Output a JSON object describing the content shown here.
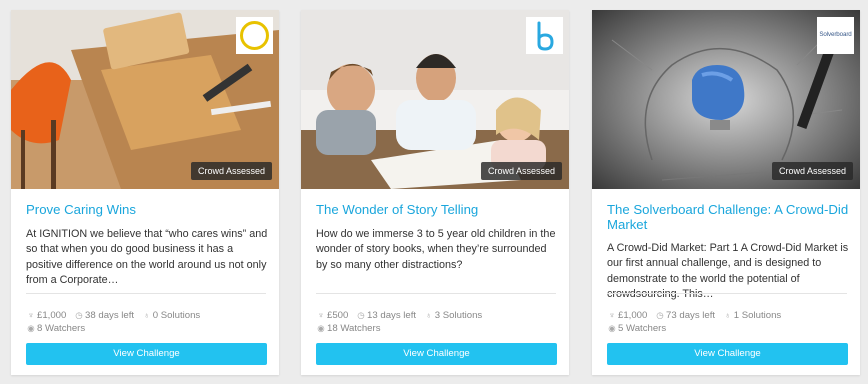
{
  "cards": [
    {
      "badge": "Crowd Assessed",
      "logo": "ignition-ring-logo",
      "title": "Prove Caring Wins",
      "description": "At IGNITION we believe that “who cares wins” and so that when you do good business it has a positive difference on the world around us not only from a Corporate…",
      "reward": "£1,000",
      "days_left": "38 days left",
      "solutions": "0 Solutions",
      "watchers": "8 Watchers",
      "button": "View Challenge"
    },
    {
      "badge": "Crowd Assessed",
      "logo": "b-letter-logo",
      "title": "The Wonder of Story Telling",
      "description": "How do we immerse 3 to 5 year old children in the wonder of story books, when they’re surrounded by so many other distractions?",
      "reward": "£500",
      "days_left": "13 days left",
      "solutions": "3 Solutions",
      "watchers": "18 Watchers",
      "button": "View Challenge"
    },
    {
      "badge": "Crowd Assessed",
      "logo": "solverboard-logo",
      "logo_text": "Solverboard",
      "title": "The Solverboard Challenge: A Crowd-Did Market",
      "description": "A Crowd-Did Market: Part 1  A Crowd-Did Market is our first annual challenge, and is designed to demonstrate to the world the potential of crowdsourcing. This…",
      "reward": "£1,000",
      "days_left": "73 days left",
      "solutions": "1 Solutions",
      "watchers": "5 Watchers",
      "button": "View Challenge"
    }
  ],
  "icons": {
    "reward": "trophy-icon",
    "days": "clock-icon",
    "solutions": "lightbulb-icon",
    "watchers": "eye-icon"
  },
  "colors": {
    "title": "#1aa6dc",
    "button": "#22c2f0",
    "background": "#ececec"
  }
}
